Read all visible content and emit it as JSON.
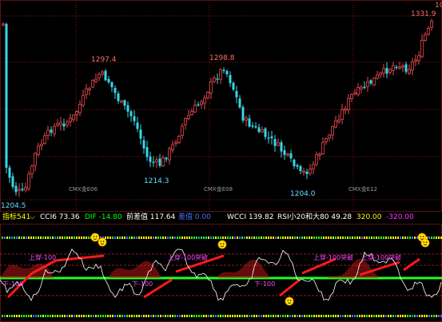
{
  "price_scale_label": "10",
  "price_labels": [
    {
      "text": "1331.9",
      "color": "#ff6b6b"
    },
    {
      "text": "1297.4",
      "color": "#ff6b6b"
    },
    {
      "text": "1298.8",
      "color": "#ff6b6b"
    },
    {
      "text": "1214.3",
      "color": "#5fe0ff"
    },
    {
      "text": "1204.0",
      "color": "#5fe0ff"
    },
    {
      "text": "1204.5",
      "color": "#5fe0ff"
    }
  ],
  "contract_labels": [
    "CMX金E06",
    "CMX金E08",
    "CMX金E12"
  ],
  "info_bar": {
    "indicator_select": "指标541",
    "cci": "CCI6 73.36",
    "dif": "DIF -14.80",
    "front_diff": "前差值 117.64",
    "blue_val": "差值 0.00",
    "wcci": "WCCI 139.82",
    "rsi": "RSI小20和大80 49.28",
    "yellow_val": "320.00",
    "magenta_val": "-320.00"
  },
  "indicator_labels": [
    "上穿-100",
    "上穿-100突破",
    "上穿-100突破",
    "上穿-100突破",
    "下-100",
    "下-100",
    "下-100"
  ],
  "colors": {
    "up_candle": "#e8494f",
    "down_candle": "#38d6e8",
    "grid": "#7a1a1a",
    "info_yellow": "#ffff00",
    "info_green": "#00ff00",
    "info_white": "#ffffff",
    "info_blue": "#4a6bff",
    "info_magenta": "#ff33ff",
    "bar_red": "#ff1a1a",
    "line_green": "#22ff22",
    "line_white": "#ffffff",
    "marker_magenta": "#ff44ff"
  }
}
